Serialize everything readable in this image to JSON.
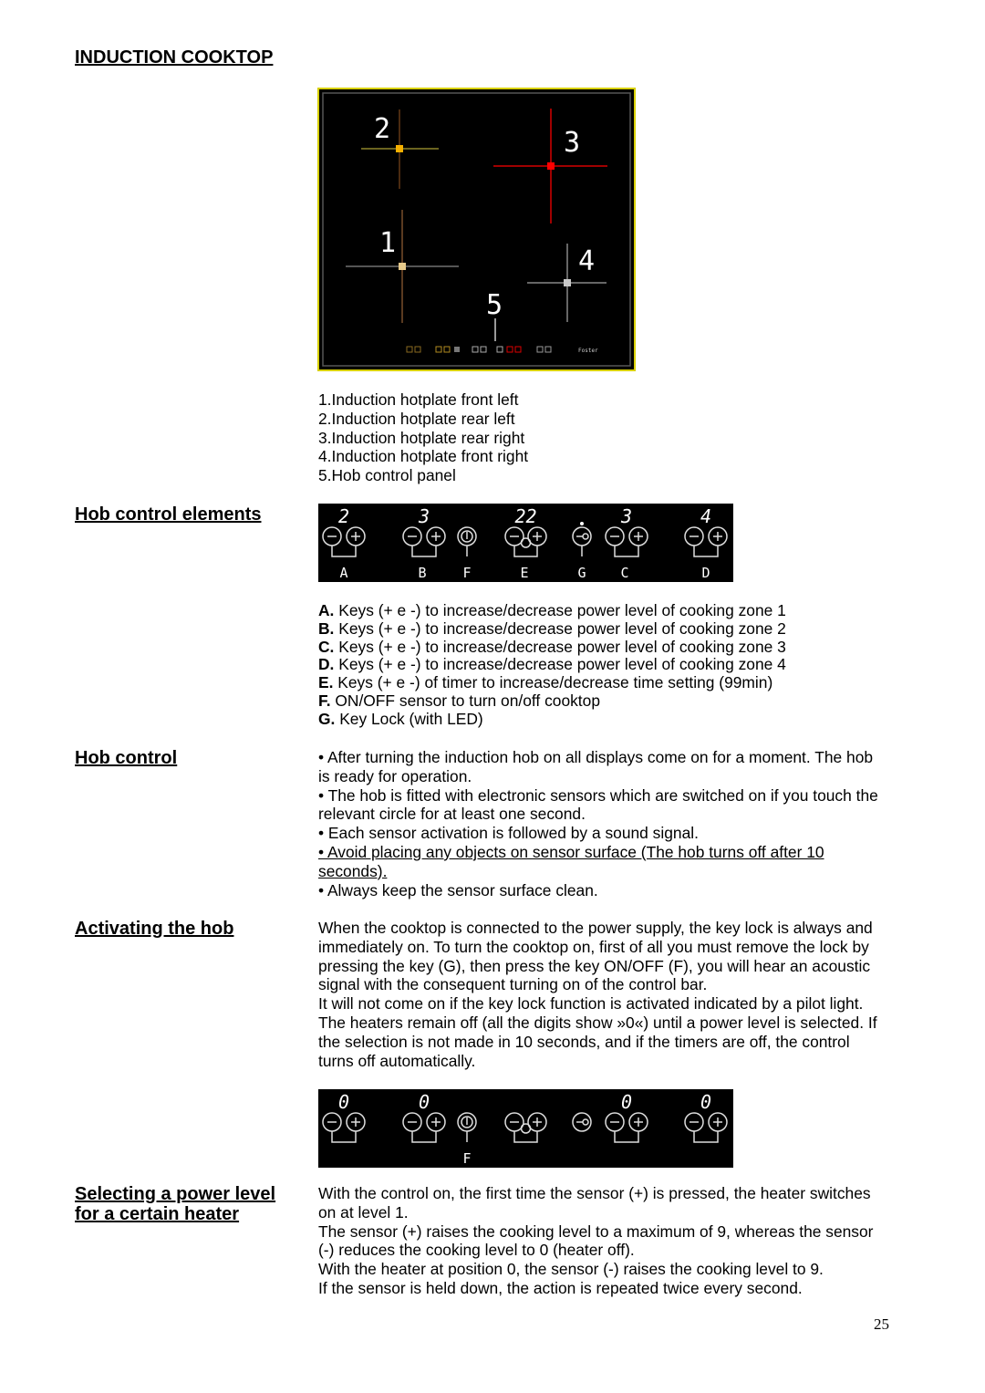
{
  "title": "INDUCTION COOKTOP",
  "cooktop_image": {
    "zone_numbers": [
      "1",
      "2",
      "3",
      "4",
      "5"
    ],
    "colors": {
      "zone1": "#e6c98a",
      "zone2": "#f5b000",
      "zone3": "#ff0000",
      "zone4": "#c8c8c8",
      "frame": "#d8d000"
    },
    "brand_logo": "Foster"
  },
  "parts_list": [
    "1.Induction hotplate front left",
    "2.Induction hotplate rear left",
    "3.Induction hotplate rear right",
    "4.Induction hotplate front right",
    "5.Hob control panel"
  ],
  "sections": {
    "control_elements": {
      "heading": "Hob control elements",
      "panel": {
        "digits": {
          "A": "2",
          "B": "3",
          "E": "22",
          "C": "3",
          "D": "4"
        },
        "labels": [
          "A",
          "B",
          "F",
          "E",
          "G",
          "C",
          "D"
        ]
      },
      "items": [
        {
          "key": "A.",
          "text": " Keys (+ e -) to increase/decrease power level of cooking zone 1"
        },
        {
          "key": "B.",
          "text": " Keys (+ e -) to increase/decrease power level of cooking zone 2"
        },
        {
          "key": "C.",
          "text": " Keys (+ e -) to increase/decrease power level of cooking zone 3"
        },
        {
          "key": "D.",
          "text": " Keys (+ e -) to increase/decrease power level of cooking zone 4"
        },
        {
          "key": "E.",
          "text": " Keys (+ e -) of timer to increase/decrease time setting (99min)"
        },
        {
          "key": "F.",
          "text": " ON/OFF sensor to turn on/off cooktop"
        },
        {
          "key": "G.",
          "text": " Key Lock (with LED)"
        }
      ]
    },
    "hob_control": {
      "heading": "Hob control",
      "lines": [
        "• After turning the induction hob on all displays come on for a moment. The hob",
        "is ready for operation.",
        "• The hob is fitted with electronic sensors which are switched on if you touch the",
        "relevant circle for at least one second.",
        "• Each sensor activation is followed by a sound signal."
      ],
      "underlined_lines": [
        "• Avoid placing any objects on sensor surface (The hob turns off after 10",
        "seconds)."
      ],
      "last_line": "• Always keep the sensor surface clean."
    },
    "activating": {
      "heading": "Activating the hob",
      "lines": [
        "When the cooktop is connected to the power supply, the key lock is always and",
        "immediately on. To turn the cooktop on, first of all you must remove the lock by",
        "pressing the key (G), then press the key ON/OFF (F), you will hear an acoustic",
        "signal with the consequent turning on of the control bar.",
        "It will not come on if the key lock function is activated indicated by a pilot light.",
        "The heaters remain off (all the digits show »0«) until a power level is selected. If",
        "the selection is not made in 10 seconds, and if the timers are off, the control",
        "turns off automatically."
      ],
      "panel": {
        "digits": {
          "A": "0",
          "B": "0",
          "C": "0",
          "D": "0"
        },
        "labels": [
          "F"
        ]
      }
    },
    "selecting": {
      "heading_line1": "Selecting a power level",
      "heading_line2": "for a certain heater",
      "lines": [
        "With the control on, the first time the sensor (+) is pressed, the heater switches",
        "on at level 1.",
        "The sensor (+) raises the cooking level to a maximum of 9, whereas the sensor",
        "(-) reduces the cooking level to 0 (heater off).",
        "With the heater at position 0, the sensor (-) raises the cooking level to 9.",
        "If the sensor is held down, the action is repeated twice every second."
      ]
    }
  },
  "page_number": "25"
}
